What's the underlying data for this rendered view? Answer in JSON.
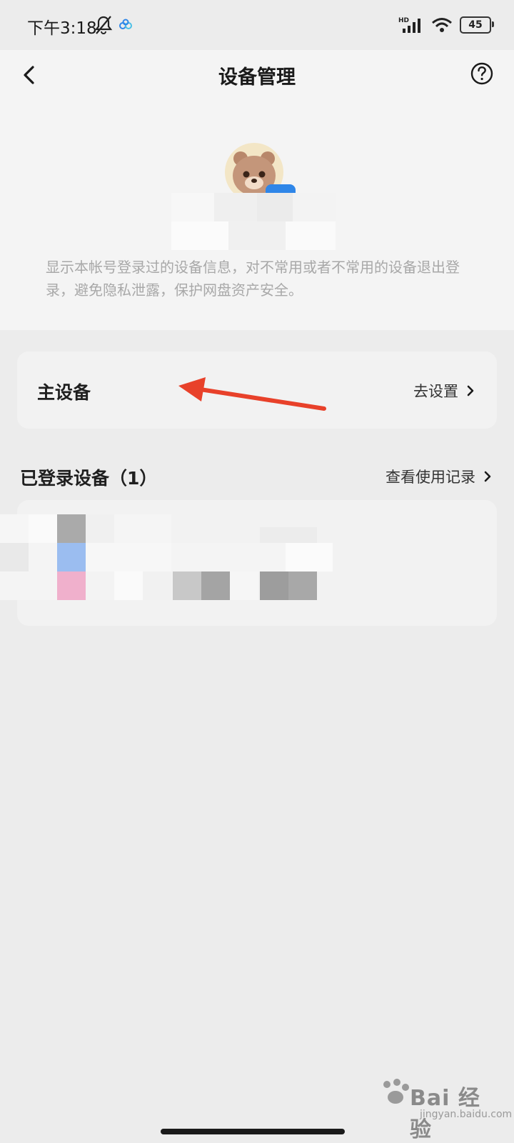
{
  "status": {
    "time": "下午3:18",
    "battery": "45",
    "network": "HD"
  },
  "nav": {
    "title": "设备管理"
  },
  "description": "显示本帐号登录过的设备信息，对不常用或者不常用的设备退出登录，避免隐私泄露，保护网盘资产安全。",
  "main_device": {
    "label": "主设备",
    "action": "去设置"
  },
  "logged_devices": {
    "title": "已登录设备（1）",
    "link": "查看使用记录"
  },
  "watermark": {
    "brand": "Bai 经验",
    "sub": "jingyan.baidu.com"
  },
  "colors": {
    "annotation_arrow": "#e8412a",
    "accent_blue": "#2f86e8",
    "avatar_bg": "#f3e6c6"
  }
}
